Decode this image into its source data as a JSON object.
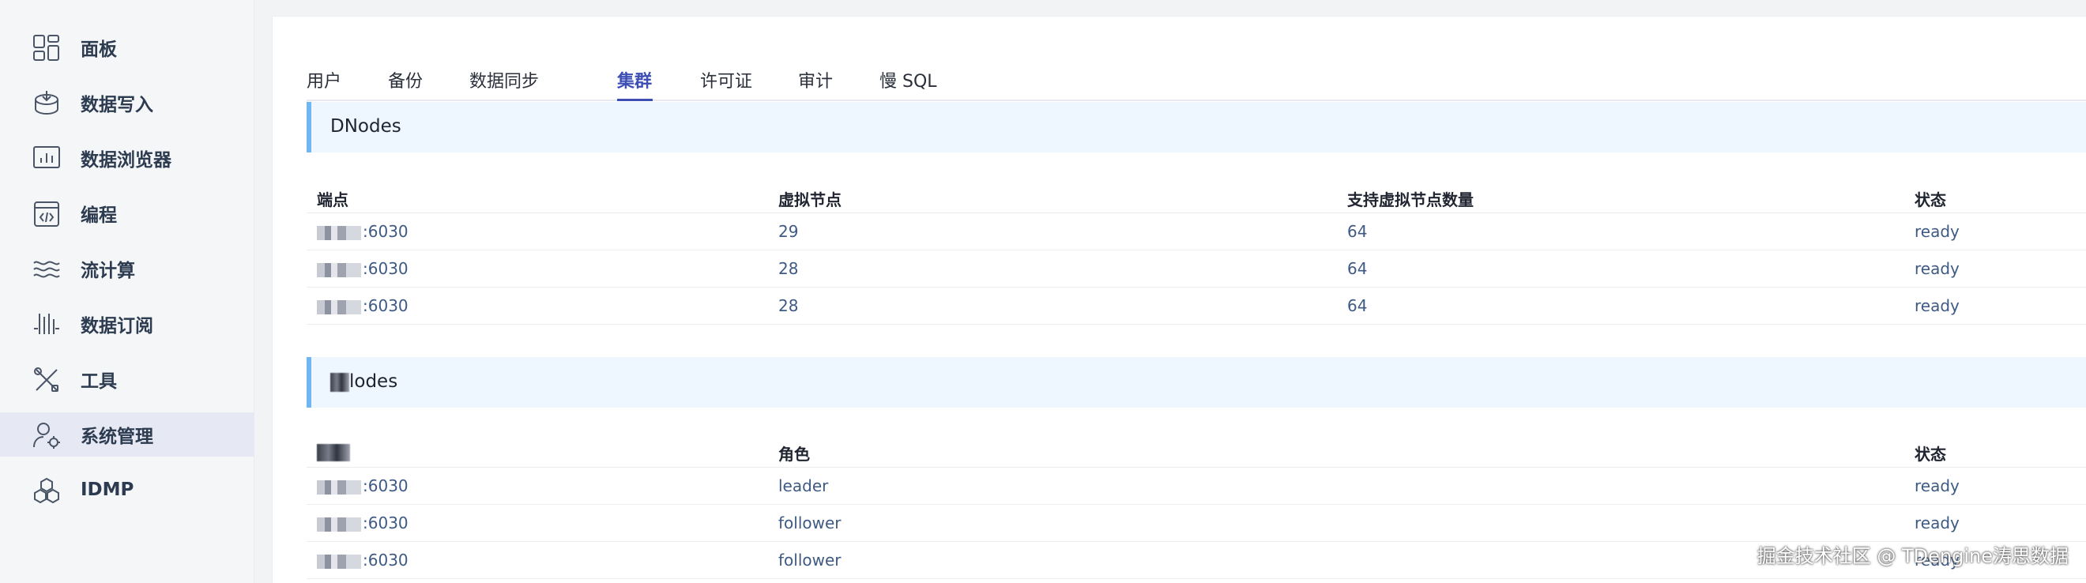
{
  "sidebar": {
    "items": [
      {
        "label": "面板",
        "icon": "dashboard-icon"
      },
      {
        "label": "数据写入",
        "icon": "database-import-icon"
      },
      {
        "label": "数据浏览器",
        "icon": "chart-browser-icon"
      },
      {
        "label": "编程",
        "icon": "code-window-icon"
      },
      {
        "label": "流计算",
        "icon": "stream-waves-icon"
      },
      {
        "label": "数据订阅",
        "icon": "subscribe-bars-icon"
      },
      {
        "label": "工具",
        "icon": "tools-icon"
      },
      {
        "label": "系统管理",
        "icon": "user-settings-icon",
        "active": true
      },
      {
        "label": "IDMP",
        "icon": "idmp-cubes-icon"
      }
    ]
  },
  "tabs": [
    {
      "label": "用户"
    },
    {
      "label": "备份"
    },
    {
      "label": "数据同步"
    },
    {
      "label": "集群",
      "active": true
    },
    {
      "label": "许可证"
    },
    {
      "label": "审计"
    },
    {
      "label": "慢 SQL"
    }
  ],
  "dnodes": {
    "title": "DNodes",
    "columns": [
      "端点",
      "虚拟节点",
      "支持虚拟节点数量",
      "状态"
    ],
    "rows": [
      {
        "endpoint": ":6030",
        "vnodes": "29",
        "supported": "64",
        "status": "ready"
      },
      {
        "endpoint": ":6030",
        "vnodes": "28",
        "supported": "64",
        "status": "ready"
      },
      {
        "endpoint": ":6030",
        "vnodes": "28",
        "supported": "64",
        "status": "ready"
      }
    ]
  },
  "mnodes": {
    "title": "lodes",
    "columns": [
      "",
      "角色",
      "状态"
    ],
    "rows": [
      {
        "endpoint": ":6030",
        "role": "leader",
        "status": "ready"
      },
      {
        "endpoint": ":6030",
        "role": "follower",
        "status": "ready"
      },
      {
        "endpoint": ":6030",
        "role": "follower",
        "status": "ready"
      }
    ]
  },
  "watermark": "掘金技术社区 @ TDengine涛思数据",
  "colors": {
    "accent": "#3d4fb4",
    "section_bar": "#6fb6f2",
    "section_bg": "#eef6ff",
    "cell_text": "#3e5a83"
  }
}
